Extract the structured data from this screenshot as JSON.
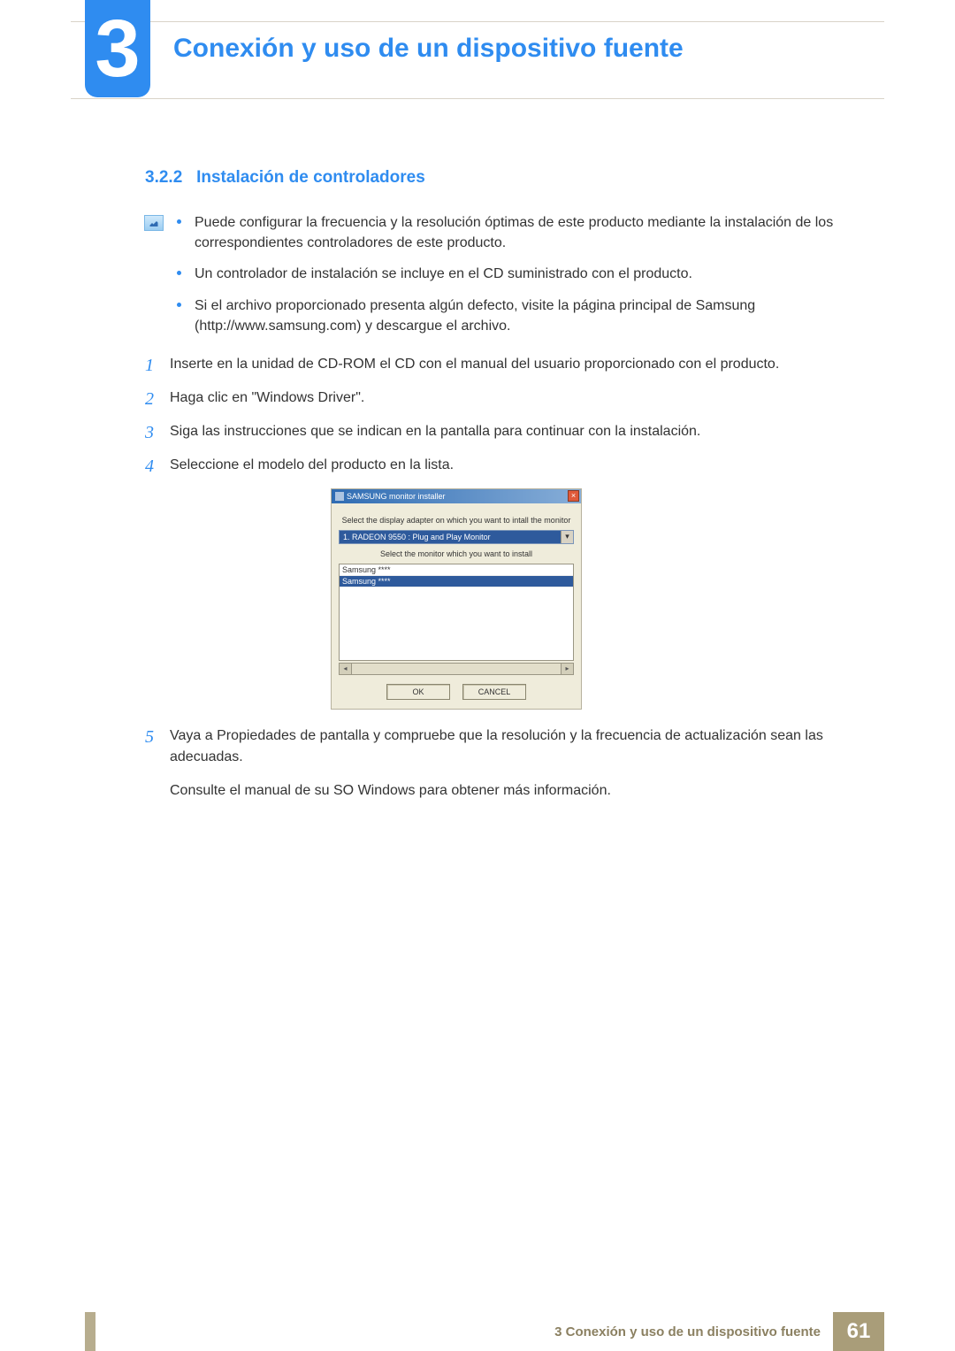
{
  "chapter": {
    "number": "3",
    "title": "Conexión y uso de un dispositivo fuente"
  },
  "section": {
    "number": "3.2.2",
    "title": "Instalación de controladores"
  },
  "notes": [
    "Puede configurar la frecuencia y la resolución óptimas de este producto mediante la instalación de los correspondientes controladores de este producto.",
    "Un controlador de instalación se incluye en el CD suministrado con el producto.",
    "Si el archivo proporcionado presenta algún defecto, visite la página principal de Samsung (http://www.samsung.com) y descargue el archivo."
  ],
  "steps": {
    "s1": {
      "n": "1",
      "text": "Inserte en la unidad de CD-ROM el CD con el manual del usuario proporcionado con el producto."
    },
    "s2": {
      "n": "2",
      "text": "Haga clic en \"Windows Driver\"."
    },
    "s3": {
      "n": "3",
      "text": "Siga las instrucciones que se indican en la pantalla para continuar con la instalación."
    },
    "s4": {
      "n": "4",
      "text": "Seleccione el modelo del producto en la lista."
    },
    "s5": {
      "n": "5",
      "text": "Vaya a Propiedades de pantalla y compruebe que la resolución y la frecuencia de actualización sean las adecuadas."
    },
    "s5b": {
      "text": "Consulte el manual de su SO Windows para obtener más información."
    }
  },
  "installer": {
    "title": "SAMSUNG monitor installer",
    "label1": "Select the display adapter on which you want to intall the monitor",
    "dropdown_value": "1. RADEON 9550 : Plug and Play Monitor",
    "label2": "Select the monitor which you want to install",
    "list_item_1": "Samsung ****",
    "list_item_2": "Samsung ****",
    "ok": "OK",
    "cancel": "CANCEL",
    "close_glyph": "×",
    "dropdown_arrow": "▾",
    "scroll_left": "◂",
    "scroll_right": "▸"
  },
  "footer": {
    "label": "3 Conexión y uso de un dispositivo fuente",
    "page": "61"
  }
}
